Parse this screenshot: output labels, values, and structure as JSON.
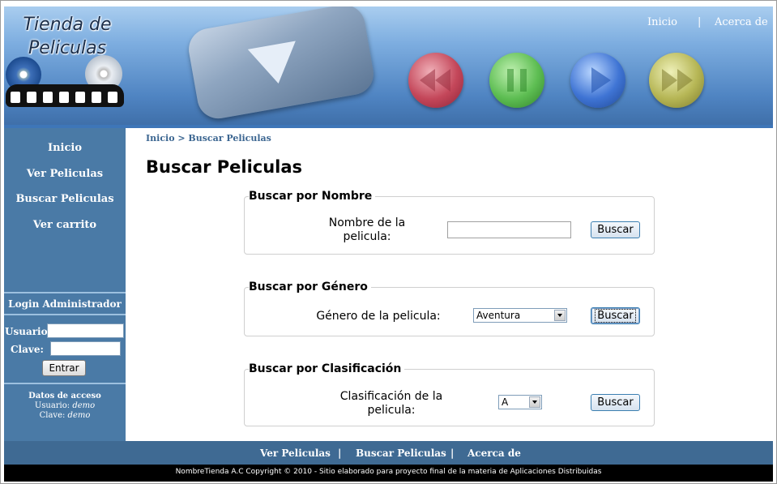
{
  "header": {
    "logo_line1": "Tienda de",
    "logo_line2": "Peliculas",
    "nav": [
      "Inicio",
      "Acerca de"
    ],
    "separator": "|"
  },
  "sidebar": {
    "items": [
      "Inicio",
      "Ver Peliculas",
      "Buscar Peliculas",
      "Ver carrito"
    ],
    "login_title": "Login Administrador",
    "user_label": "Usuario:",
    "password_label": "Clave:",
    "submit_label": "Entrar",
    "access_title": "Datos de acceso",
    "access_user_label": "Usuario:",
    "access_user": "demo",
    "access_password_label": "Clave:",
    "access_password": "demo"
  },
  "main": {
    "breadcrumb": "Inicio > Buscar Peliculas",
    "title": "Buscar Peliculas",
    "by_name": {
      "legend": "Buscar por Nombre",
      "label_line1": "Nombre de la",
      "label_line2": "pelicula:",
      "value": "",
      "button": "Buscar"
    },
    "by_genre": {
      "legend": "Buscar por Género",
      "label": "Género de la pelicula:",
      "selected": "Aventura",
      "button": "Buscar"
    },
    "by_rating": {
      "legend": "Buscar por Clasificación",
      "label_line1": "Clasificación de la",
      "label_line2": "pelicula:",
      "selected": "A",
      "button": "Buscar"
    }
  },
  "footer": {
    "nav": [
      "Ver Peliculas",
      "Buscar Peliculas",
      "Acerca de"
    ],
    "separator": "|",
    "copyright": "NombreTienda A.C Copyright © 2010 - Sitio elaborado para proyecto final de la materia de Aplicaciones Distribuidas"
  },
  "colors": {
    "sidebar": "#4a7aa6",
    "footer_nav": "#3f6a93",
    "footer": "#000000",
    "breadcrumb": "#3c6691"
  },
  "icons": [
    "film-strip-icon",
    "dvd-disc-icon",
    "play-icon",
    "rewind-icon",
    "pause-icon",
    "forward-icon"
  ]
}
